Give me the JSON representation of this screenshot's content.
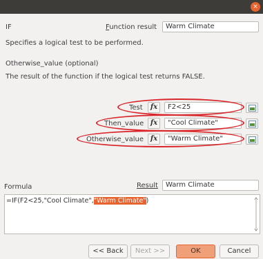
{
  "window": {
    "close_icon": "×"
  },
  "header": {
    "function_name": "IF",
    "function_result_label": "Function result",
    "function_result_value": "Warm Climate"
  },
  "description": "Specifies a logical test to be performed.",
  "param_info": {
    "title": "Otherwise_value (optional)",
    "text": "The result of the function if the logical test returns FALSE."
  },
  "params": [
    {
      "label": "Test",
      "fx": "fx",
      "value": "F2<25"
    },
    {
      "label": "Then_value",
      "fx": "fx",
      "value": "\"Cool Climate\""
    },
    {
      "label": "Otherwise_value",
      "fx": "fx",
      "value": "\"Warm Climate\""
    }
  ],
  "formula": {
    "label": "Formula",
    "result_label": "Result",
    "result_value": "Warm Climate",
    "text_before": "=IF(F2<25,\"Cool Climate\",",
    "text_selected": "\"Warm Climate\"",
    "text_after": ")"
  },
  "buttons": {
    "back": "<< Back",
    "next": "Next >>",
    "ok": "OK",
    "cancel": "Cancel"
  },
  "colors": {
    "accent": "#e9632f",
    "highlight_ring": "#d9262a",
    "titlebar": "#3d3c39"
  }
}
